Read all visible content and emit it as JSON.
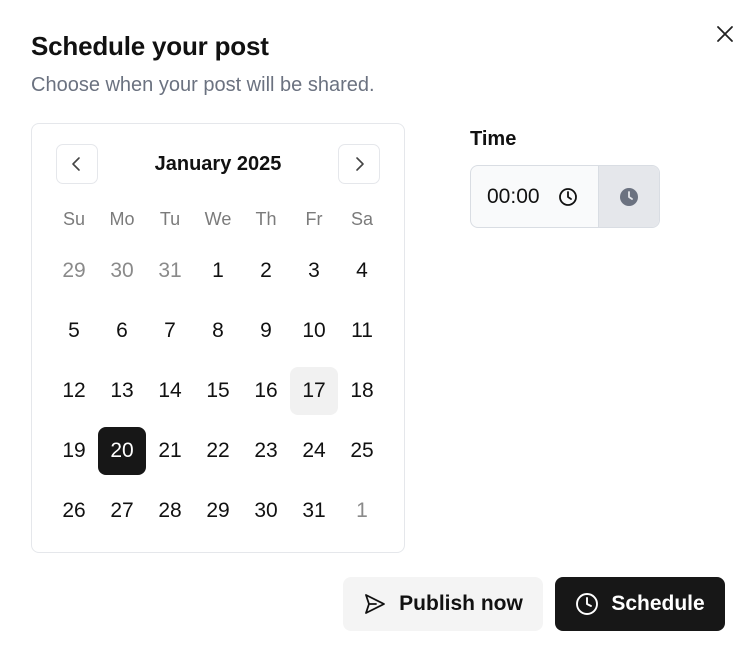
{
  "dialog": {
    "title": "Schedule your post",
    "subtitle": "Choose when your post will be shared.",
    "close_icon": "close-icon"
  },
  "calendar": {
    "month_label": "January 2025",
    "prev_icon": "chevron-left-icon",
    "next_icon": "chevron-right-icon",
    "weekdays": [
      "Su",
      "Mo",
      "Tu",
      "We",
      "Th",
      "Fr",
      "Sa"
    ],
    "days": [
      {
        "label": "29",
        "outside": true
      },
      {
        "label": "30",
        "outside": true
      },
      {
        "label": "31",
        "outside": true
      },
      {
        "label": "1"
      },
      {
        "label": "2"
      },
      {
        "label": "3"
      },
      {
        "label": "4"
      },
      {
        "label": "5"
      },
      {
        "label": "6"
      },
      {
        "label": "7"
      },
      {
        "label": "8"
      },
      {
        "label": "9"
      },
      {
        "label": "10"
      },
      {
        "label": "11"
      },
      {
        "label": "12"
      },
      {
        "label": "13"
      },
      {
        "label": "14"
      },
      {
        "label": "15"
      },
      {
        "label": "16"
      },
      {
        "label": "17",
        "today": true
      },
      {
        "label": "18"
      },
      {
        "label": "19"
      },
      {
        "label": "20",
        "selected": true
      },
      {
        "label": "21"
      },
      {
        "label": "22"
      },
      {
        "label": "23"
      },
      {
        "label": "24"
      },
      {
        "label": "25"
      },
      {
        "label": "26"
      },
      {
        "label": "27"
      },
      {
        "label": "28"
      },
      {
        "label": "29"
      },
      {
        "label": "30"
      },
      {
        "label": "31"
      },
      {
        "label": "1",
        "outside": true
      }
    ],
    "colors": {
      "selected_bg": "#171717",
      "today_bg": "#f1f1f1",
      "outside_text": "#8a8a8a"
    }
  },
  "time": {
    "label": "Time",
    "value": "00:00",
    "input_icon": "clock-outline-icon",
    "addon_icon": "clock-filled-icon"
  },
  "actions": {
    "publish_label": "Publish now",
    "publish_icon": "send-icon",
    "schedule_label": "Schedule",
    "schedule_icon": "clock-icon",
    "colors": {
      "primary_bg": "#171717",
      "secondary_bg": "#f4f4f4"
    }
  }
}
